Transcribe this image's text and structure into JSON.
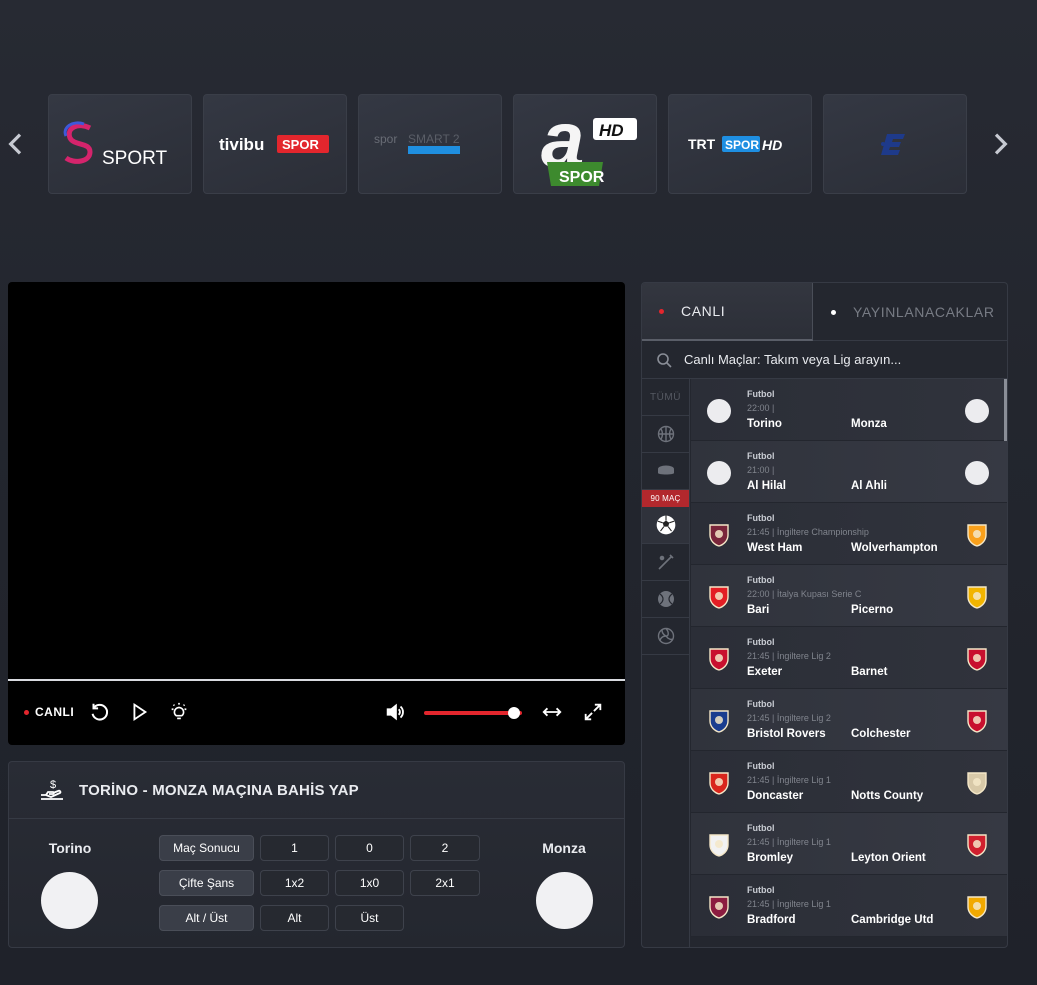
{
  "channels": [
    {
      "name": "S SPORT"
    },
    {
      "name": "tivibu SPOR"
    },
    {
      "name": "spor SMART 2"
    },
    {
      "name": "a SPOR HD"
    },
    {
      "name": "TRT SPOR HD"
    },
    {
      "name": "Eurosport"
    }
  ],
  "player": {
    "live_label": "CANLI",
    "volume": 0.92
  },
  "bet": {
    "title": "TORİNO - MONZA MAÇINA BAHİS YAP",
    "home_team": "Torino",
    "away_team": "Monza",
    "rows": [
      {
        "category": "Maç Sonucu",
        "options": [
          "1",
          "0",
          "2"
        ]
      },
      {
        "category": "Çifte Şans",
        "options": [
          "1x2",
          "1x0",
          "2x1"
        ]
      },
      {
        "category": "Alt / Üst",
        "options": [
          "Alt",
          "Üst"
        ]
      }
    ]
  },
  "panel": {
    "tab_live": "CANLI",
    "tab_upcoming": "YAYINLANACAKLAR",
    "search_placeholder": "Canlı Maçlar: Takım veya Lig arayın...",
    "all_label": "TÜMÜ",
    "match_count": "90 MAÇ",
    "colors": {
      "live": "#e3262d",
      "badge": "#b2282d"
    },
    "sports": [
      "basketball-icon",
      "hockey-puck-icon",
      "football-icon",
      "cricket-bat-icon",
      "tennis-ball-icon",
      "volleyball-icon"
    ]
  },
  "matches": [
    {
      "sport": "Futbol",
      "meta": "22:00 |",
      "home": "Torino",
      "away": "Monza",
      "home_color": "#ececef",
      "away_color": "#ececef"
    },
    {
      "sport": "Futbol",
      "meta": "21:00 |",
      "home": "Al Hilal",
      "away": "Al Ahli",
      "home_color": "#ececef",
      "away_color": "#ececef"
    },
    {
      "sport": "Futbol",
      "meta": "21:45 | İngiltere Championship",
      "home": "West Ham",
      "away": "Wolverhampton",
      "home_color": "#7a263a",
      "away_color": "#f9a01b"
    },
    {
      "sport": "Futbol",
      "meta": "22:00 | İtalya Kupası Serie C",
      "home": "Bari",
      "away": "Picerno",
      "home_color": "#e31e24",
      "away_color": "#f2b400"
    },
    {
      "sport": "Futbol",
      "meta": "21:45 | İngiltere Lig 2",
      "home": "Exeter",
      "away": "Barnet",
      "home_color": "#c8102e",
      "away_color": "#c8102e"
    },
    {
      "sport": "Futbol",
      "meta": "21:45 | İngiltere Lig 2",
      "home": "Bristol Rovers",
      "away": "Colchester",
      "home_color": "#1a3d8f",
      "away_color": "#c8102e"
    },
    {
      "sport": "Futbol",
      "meta": "21:45 | İngiltere Lig 1",
      "home": "Doncaster",
      "away": "Notts County",
      "home_color": "#d9261c",
      "away_color": "#d8c9a8"
    },
    {
      "sport": "Futbol",
      "meta": "21:45 | İngiltere Lig 1",
      "home": "Bromley",
      "away": "Leyton Orient",
      "home_color": "#f2f2f2",
      "away_color": "#d0202e"
    },
    {
      "sport": "Futbol",
      "meta": "21:45 | İngiltere Lig 1",
      "home": "Bradford",
      "away": "Cambridge Utd",
      "home_color": "#8c1d40",
      "away_color": "#f2a900"
    }
  ]
}
